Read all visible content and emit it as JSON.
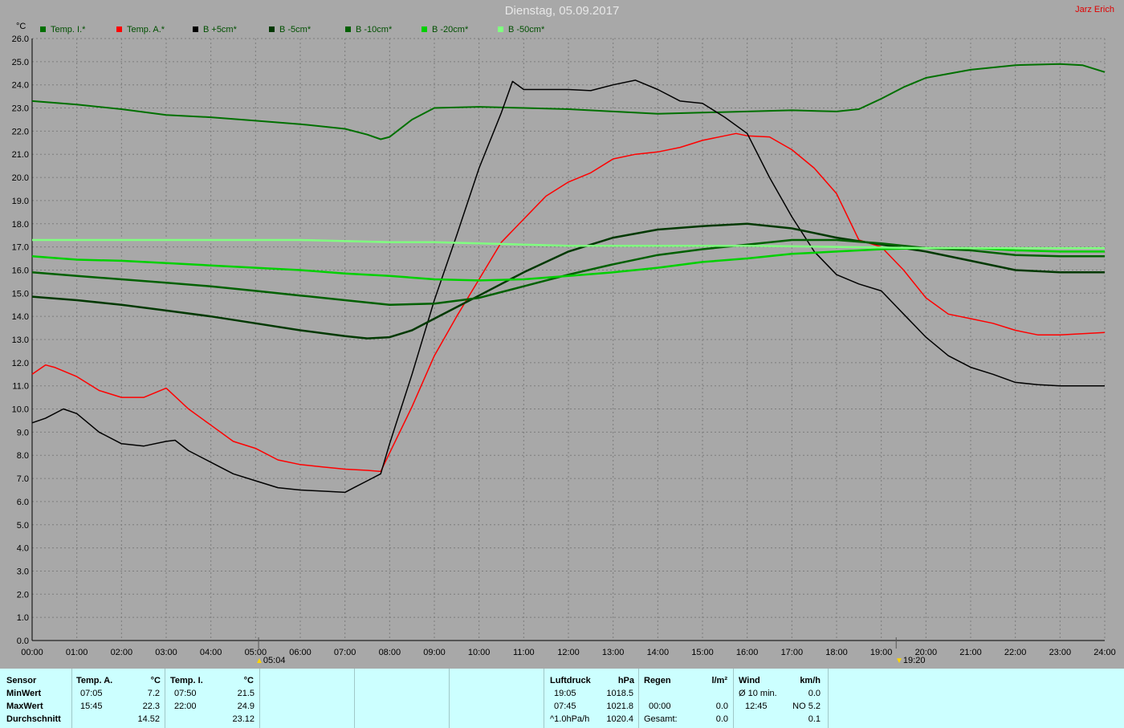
{
  "title": "Dienstag, 05.09.2017",
  "author": "Jarz Erich",
  "unit_label": "°C",
  "sunrise": "05:04",
  "sunset": "19:20",
  "legend": [
    {
      "name": "Temp. I.*",
      "color": "#007000"
    },
    {
      "name": "Temp. A.*",
      "color": "#ff0000"
    },
    {
      "name": "B +5cm*",
      "color": "#000000"
    },
    {
      "name": "B -5cm*",
      "color": "#003800"
    },
    {
      "name": "B -10cm*",
      "color": "#006000"
    },
    {
      "name": "B -20cm*",
      "color": "#00d000"
    },
    {
      "name": "B -50cm*",
      "color": "#80ff80"
    }
  ],
  "chart_data": {
    "type": "line",
    "xlim": [
      0,
      24
    ],
    "ylim": [
      0,
      26
    ],
    "grid": true,
    "x_ticks": [
      "00:00",
      "01:00",
      "02:00",
      "03:00",
      "04:00",
      "05:00",
      "06:00",
      "07:00",
      "08:00",
      "09:00",
      "10:00",
      "11:00",
      "12:00",
      "13:00",
      "14:00",
      "15:00",
      "16:00",
      "17:00",
      "18:00",
      "19:00",
      "20:00",
      "21:00",
      "22:00",
      "23:00",
      "24:00"
    ],
    "y_ticks": [
      "0.0",
      "1.0",
      "2.0",
      "3.0",
      "4.0",
      "5.0",
      "6.0",
      "7.0",
      "8.0",
      "9.0",
      "10.0",
      "11.0",
      "12.0",
      "13.0",
      "14.0",
      "15.0",
      "16.0",
      "17.0",
      "18.0",
      "19.0",
      "20.0",
      "21.0",
      "22.0",
      "23.0",
      "24.0",
      "25.0",
      "26.0"
    ],
    "series": [
      {
        "name": "Temp. I.*",
        "color": "#007000",
        "width": 2,
        "x": [
          0,
          1,
          2,
          3,
          4,
          5,
          6,
          7,
          7.5,
          7.8,
          8,
          8.5,
          9,
          10,
          11,
          12,
          13,
          14,
          15,
          16,
          17,
          18,
          18.5,
          19,
          19.5,
          20,
          21,
          22,
          23,
          23.5,
          24
        ],
        "y": [
          23.3,
          23.15,
          22.95,
          22.7,
          22.6,
          22.45,
          22.3,
          22.1,
          21.85,
          21.65,
          21.75,
          22.5,
          23.0,
          23.05,
          23.0,
          22.95,
          22.85,
          22.75,
          22.8,
          22.85,
          22.9,
          22.85,
          22.95,
          23.4,
          23.9,
          24.3,
          24.65,
          24.85,
          24.9,
          24.85,
          24.55
        ]
      },
      {
        "name": "Temp. A.*",
        "color": "#ff0000",
        "width": 1.5,
        "x": [
          0,
          0.3,
          0.5,
          1,
          1.5,
          2,
          2.5,
          3,
          3.5,
          4,
          4.5,
          5,
          5.5,
          6,
          6.5,
          7,
          7.5,
          7.8,
          8,
          8.5,
          9,
          9.5,
          10,
          10.5,
          11,
          11.5,
          12,
          12.5,
          13,
          13.5,
          14,
          14.5,
          15,
          15.5,
          15.75,
          16,
          16.5,
          17,
          17.5,
          18,
          18.5,
          19,
          19.5,
          20,
          20.5,
          21,
          21.5,
          22,
          22.5,
          23,
          23.5,
          24
        ],
        "y": [
          11.5,
          11.9,
          11.8,
          11.4,
          10.8,
          10.5,
          10.5,
          10.9,
          10.0,
          9.3,
          8.6,
          8.3,
          7.8,
          7.6,
          7.5,
          7.4,
          7.35,
          7.3,
          8.1,
          10.1,
          12.3,
          14.0,
          15.6,
          17.2,
          18.2,
          19.2,
          19.8,
          20.2,
          20.8,
          21.0,
          21.1,
          21.3,
          21.6,
          21.8,
          21.9,
          21.8,
          21.75,
          21.2,
          20.4,
          19.3,
          17.3,
          17.0,
          16.0,
          14.8,
          14.1,
          13.9,
          13.7,
          13.4,
          13.2,
          13.2,
          13.25,
          13.3
        ]
      },
      {
        "name": "B +5cm*",
        "color": "#000000",
        "width": 1.5,
        "x": [
          0,
          0.3,
          0.7,
          1,
          1.5,
          2,
          2.5,
          3,
          3.2,
          3.5,
          4,
          4.5,
          5,
          5.5,
          6,
          6.5,
          7,
          7.2,
          7.5,
          7.8,
          8,
          8.5,
          9,
          9.5,
          10,
          10.5,
          10.75,
          11,
          11.5,
          12,
          12.5,
          13,
          13.5,
          14,
          14.5,
          15,
          15.5,
          16,
          16.5,
          17,
          17.5,
          18,
          18.5,
          19,
          19.5,
          20,
          20.5,
          21,
          21.5,
          22,
          22.5,
          23,
          24
        ],
        "y": [
          9.4,
          9.6,
          10.0,
          9.8,
          9.0,
          8.5,
          8.4,
          8.6,
          8.65,
          8.2,
          7.7,
          7.2,
          6.9,
          6.6,
          6.5,
          6.45,
          6.4,
          6.6,
          6.9,
          7.2,
          8.5,
          11.5,
          14.7,
          17.5,
          20.4,
          22.8,
          24.15,
          23.8,
          23.8,
          23.8,
          23.75,
          24.0,
          24.2,
          23.8,
          23.3,
          23.2,
          22.6,
          21.9,
          20.0,
          18.3,
          16.8,
          15.8,
          15.4,
          15.1,
          14.1,
          13.1,
          12.3,
          11.8,
          11.5,
          11.15,
          11.05,
          11.0,
          11.0
        ]
      },
      {
        "name": "B -5cm*",
        "color": "#003800",
        "width": 2.5,
        "x": [
          0,
          1,
          2,
          3,
          4,
          5,
          6,
          7,
          7.5,
          8,
          8.5,
          9,
          10,
          11,
          12,
          13,
          14,
          15,
          16,
          17,
          18,
          19,
          20,
          21,
          22,
          23,
          24
        ],
        "y": [
          14.85,
          14.7,
          14.5,
          14.25,
          14.0,
          13.7,
          13.4,
          13.15,
          13.05,
          13.1,
          13.4,
          13.9,
          14.9,
          15.9,
          16.8,
          17.4,
          17.75,
          17.9,
          18.0,
          17.8,
          17.4,
          17.1,
          16.8,
          16.4,
          16.0,
          15.9,
          15.9
        ]
      },
      {
        "name": "B -10cm*",
        "color": "#006000",
        "width": 2.5,
        "x": [
          0,
          1,
          2,
          3,
          4,
          5,
          6,
          7,
          8,
          9,
          10,
          11,
          12,
          13,
          14,
          15,
          16,
          17,
          18,
          19,
          20,
          21,
          22,
          23,
          24
        ],
        "y": [
          15.9,
          15.75,
          15.6,
          15.45,
          15.3,
          15.1,
          14.9,
          14.7,
          14.5,
          14.55,
          14.8,
          15.3,
          15.8,
          16.25,
          16.65,
          16.9,
          17.1,
          17.3,
          17.3,
          17.15,
          16.95,
          16.85,
          16.65,
          16.6,
          16.6
        ]
      },
      {
        "name": "B -20cm*",
        "color": "#00d000",
        "width": 2.5,
        "x": [
          0,
          1,
          2,
          3,
          4,
          5,
          6,
          7,
          8,
          9,
          10,
          11,
          12,
          13,
          14,
          15,
          16,
          17,
          18,
          19,
          20,
          21,
          22,
          23,
          24
        ],
        "y": [
          16.6,
          16.45,
          16.4,
          16.3,
          16.2,
          16.1,
          16.0,
          15.85,
          15.75,
          15.6,
          15.55,
          15.6,
          15.75,
          15.9,
          16.1,
          16.35,
          16.5,
          16.7,
          16.8,
          16.9,
          16.95,
          16.95,
          16.85,
          16.8,
          16.8
        ]
      },
      {
        "name": "B -50cm*",
        "color": "#80ff80",
        "width": 2.5,
        "x": [
          0,
          2,
          4,
          6,
          8,
          9,
          10,
          11,
          12,
          14,
          16,
          18,
          20,
          22,
          24
        ],
        "y": [
          17.3,
          17.3,
          17.3,
          17.3,
          17.2,
          17.2,
          17.15,
          17.1,
          17.05,
          17.05,
          17.05,
          17.0,
          16.95,
          16.95,
          16.95
        ]
      }
    ]
  },
  "stats": {
    "sensor_header": "Sensor",
    "rows": [
      "MinWert",
      "MaxWert",
      "Durchschnitt"
    ],
    "temp_a": {
      "header": "Temp. A.",
      "unit": "°C",
      "min_time": "07:05",
      "min_value": "7.2",
      "max_time": "15:45",
      "max_value": "22.3",
      "avg_value": "14.52"
    },
    "temp_i": {
      "header": "Temp. I.",
      "unit": "°C",
      "min_time": "07:50",
      "min_value": "21.5",
      "max_time": "22:00",
      "max_value": "24.9",
      "avg_value": "23.12"
    },
    "pressure": {
      "header": "Luftdruck",
      "unit": "hPa",
      "r1_time": "19:05",
      "r1_value": "1018.5",
      "r2_time": "07:45",
      "r2_value": "1021.8",
      "r3_label": "^1.0hPa/h",
      "r3_value": "1020.4"
    },
    "rain": {
      "header": "Regen",
      "unit": "l/m²",
      "r2_time": "00:00",
      "r2_value": "0.0",
      "r3_label": "Gesamt:",
      "r3_value": "0.0"
    },
    "wind": {
      "header": "Wind",
      "unit": "km/h",
      "r1_label": "Ø 10 min.",
      "r1_value": "0.0",
      "r2_time": "12:45",
      "r2_value": "NO 5.2",
      "r3_value": "0.1"
    }
  }
}
